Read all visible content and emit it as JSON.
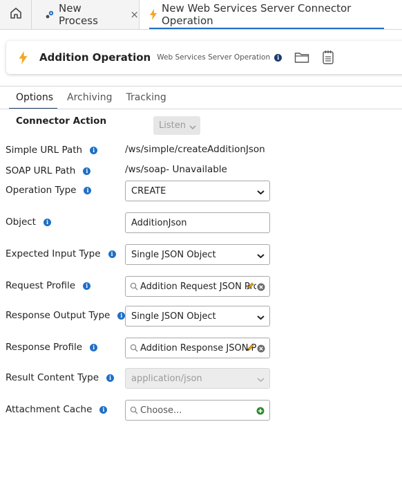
{
  "tabs": {
    "home_icon": "home-icon",
    "items": [
      {
        "label": "New Process",
        "icon": "process-icon"
      },
      {
        "label": "New Web Services Server Connector Operation",
        "icon": "lightning-icon"
      }
    ],
    "close_glyph": "×"
  },
  "header": {
    "title": "Addition Operation",
    "subtitle": "Web Services Server Operation",
    "info_glyph": "i",
    "accent_color": "#f5a623"
  },
  "subtabs": [
    "Options",
    "Archiving",
    "Tracking"
  ],
  "form": {
    "connector_action": {
      "label": "Connector Action",
      "value": "Listen"
    },
    "simple_url": {
      "label": "Simple URL Path",
      "value": "/ws/simple/createAdditionJson"
    },
    "soap_url": {
      "label": "SOAP URL Path",
      "value": "/ws/soap- Unavailable"
    },
    "operation_type": {
      "label": "Operation Type",
      "value": "CREATE"
    },
    "object": {
      "label": "Object",
      "value": "AdditionJson"
    },
    "expected_input_type": {
      "label": "Expected Input Type",
      "value": "Single JSON Object"
    },
    "request_profile": {
      "label": "Request Profile",
      "value": "Addition Request JSON Profile"
    },
    "response_output_type": {
      "label": "Response Output Type",
      "value": "Single JSON Object"
    },
    "response_profile": {
      "label": "Response Profile",
      "value": "Addition Response JSON Profile"
    },
    "result_content_type": {
      "label": "Result Content Type",
      "value": "application/json"
    },
    "attachment_cache": {
      "label": "Attachment Cache",
      "placeholder": "Choose..."
    }
  },
  "info_glyph": "i"
}
